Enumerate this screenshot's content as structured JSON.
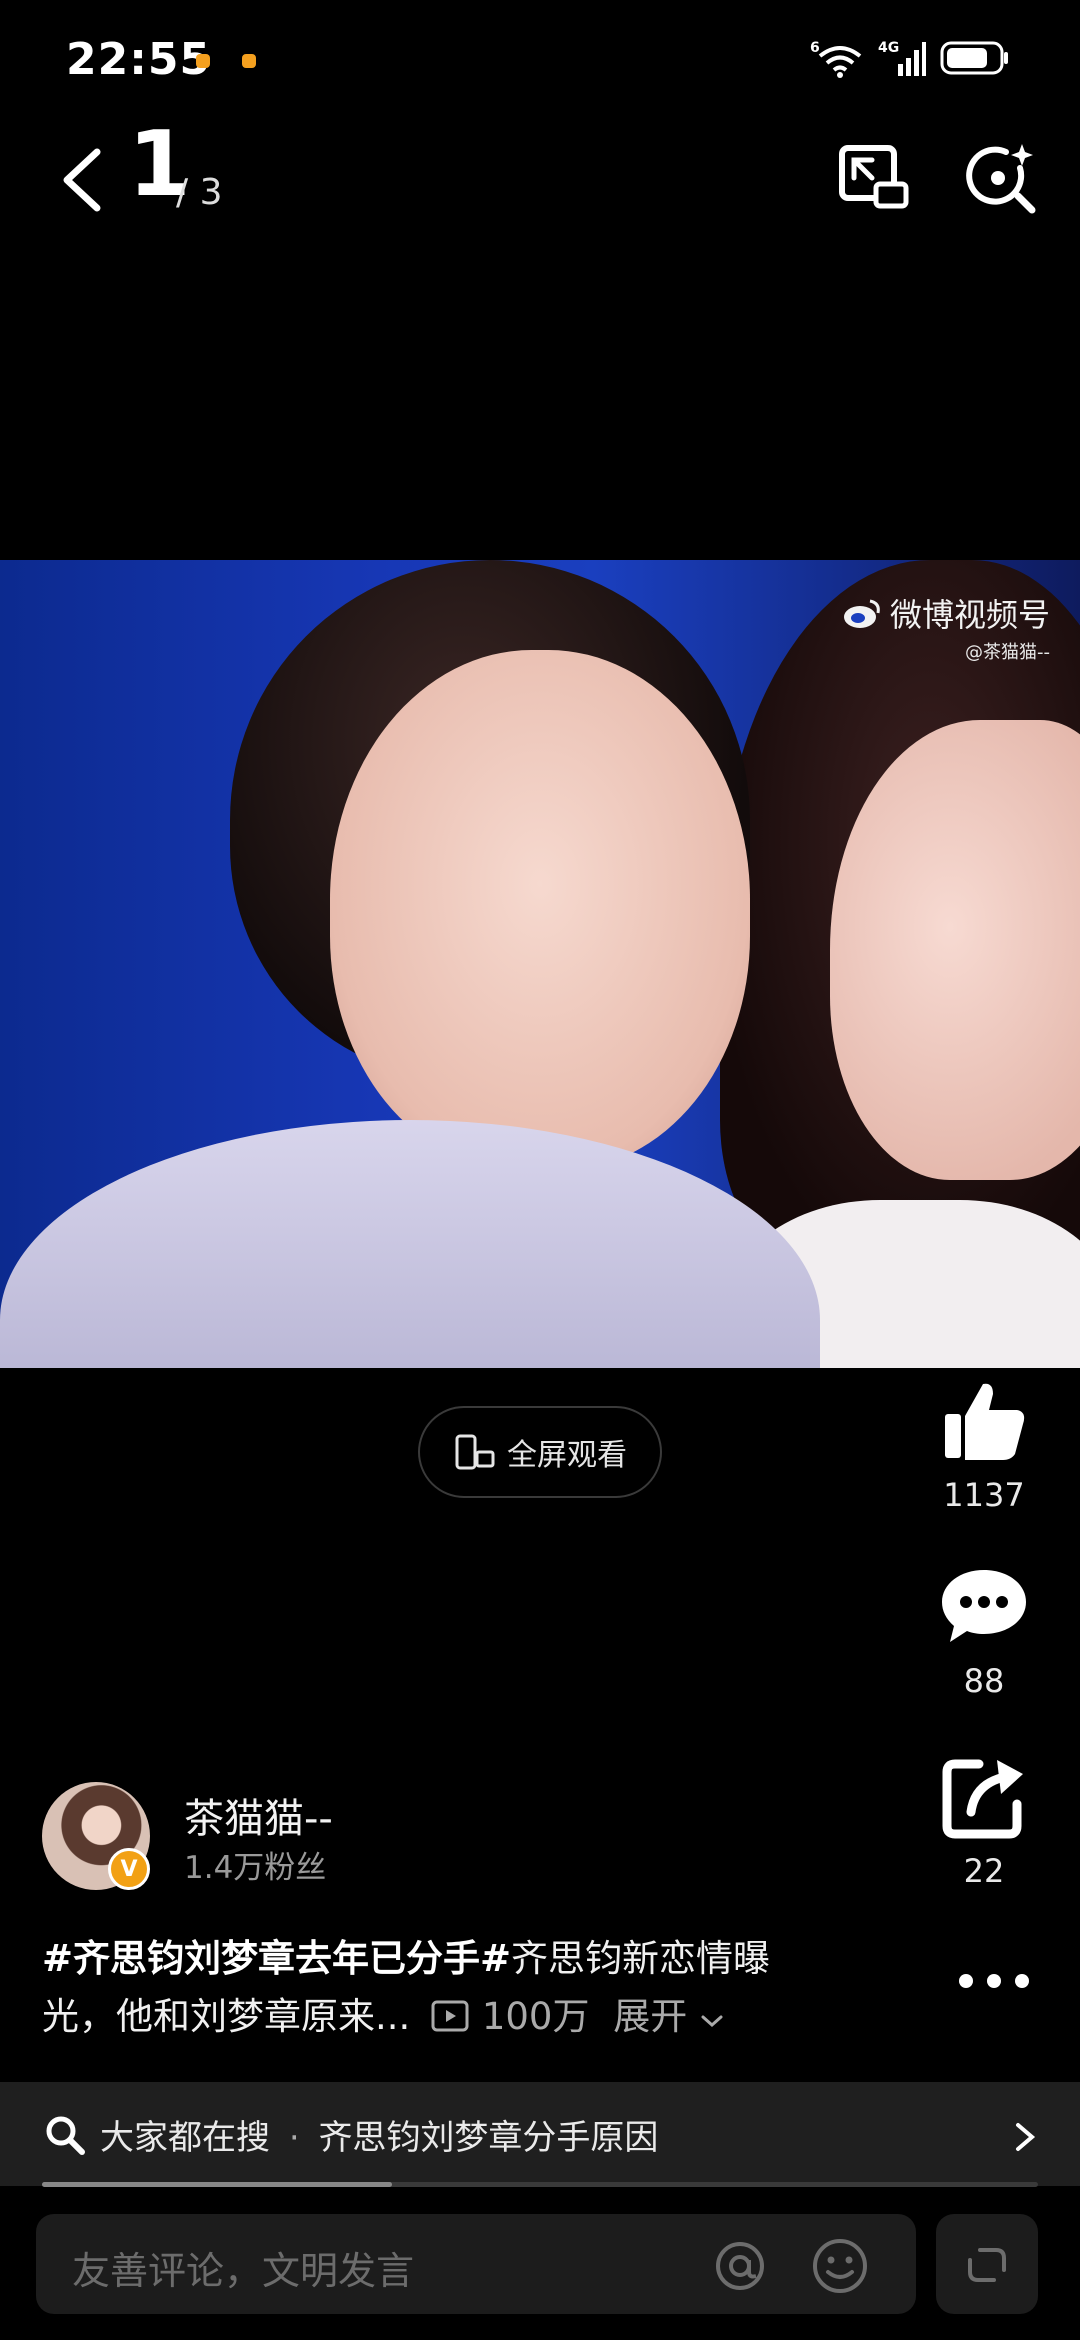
{
  "status_bar": {
    "time": "22:55",
    "network": "4G",
    "wifi_badge": "6",
    "accent_color": "#f4a01f"
  },
  "nav": {
    "page_current": "1",
    "page_total": "/ 3",
    "icons": [
      "back-icon",
      "picture-in-picture-icon",
      "image-search-icon"
    ]
  },
  "video": {
    "watermark_main": "微博视频号",
    "watermark_sub": "@茶猫猫--"
  },
  "fullscreen_label": "全屏观看",
  "actions": {
    "like_count": "1137",
    "comment_count": "88",
    "share_count": "22"
  },
  "author": {
    "name": "茶猫猫--",
    "fans": "1.4万粉丝",
    "verified_mark": "V"
  },
  "description": {
    "hashtag1": "#齐思钧刘梦章去年已分手#",
    "text": "齐思钧新恋情曝光，他和刘梦章原来...",
    "views": "100万",
    "expand_label": "展开"
  },
  "search": {
    "prefix": "大家都在搜",
    "separator": "·",
    "query": "齐思钧刘梦章分手原因"
  },
  "comment": {
    "placeholder": "友善评论，文明发言"
  }
}
